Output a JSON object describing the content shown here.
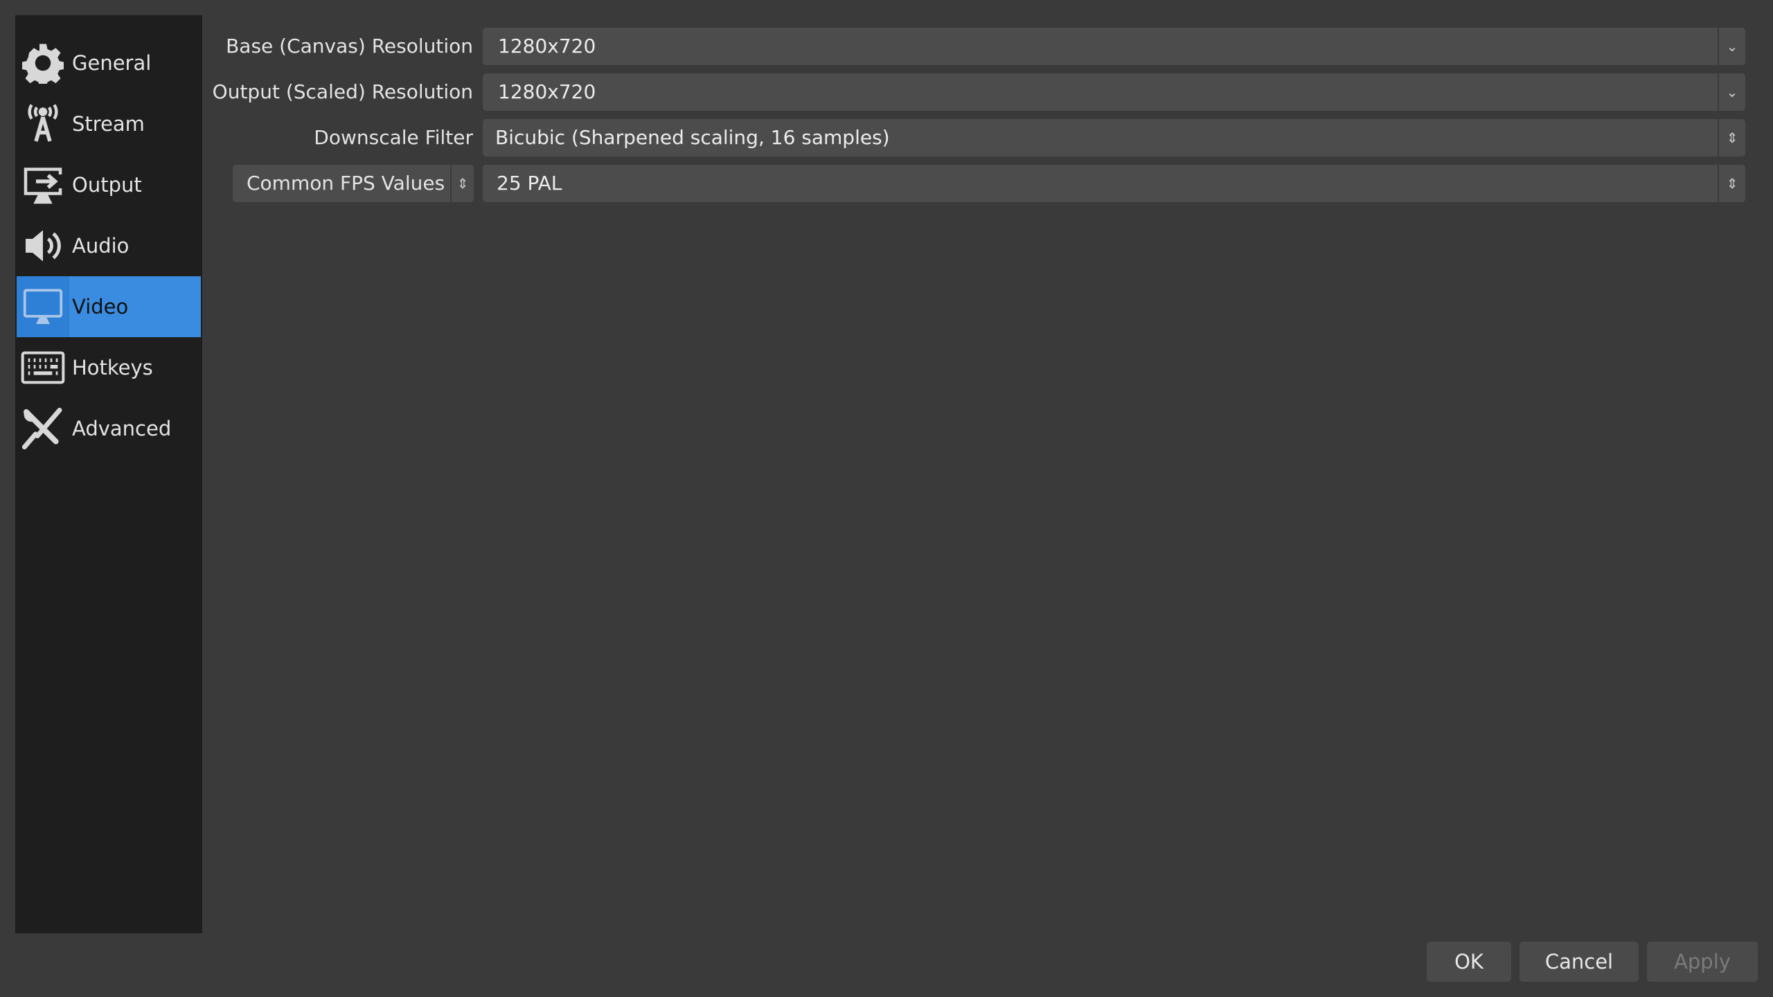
{
  "sidebar": {
    "items": [
      {
        "label": "General",
        "icon": "gear-icon"
      },
      {
        "label": "Stream",
        "icon": "antenna-icon"
      },
      {
        "label": "Output",
        "icon": "monitor-arrow-icon"
      },
      {
        "label": "Audio",
        "icon": "speaker-icon"
      },
      {
        "label": "Video",
        "icon": "monitor-icon",
        "selected": true
      },
      {
        "label": "Hotkeys",
        "icon": "keyboard-icon"
      },
      {
        "label": "Advanced",
        "icon": "tools-icon"
      }
    ]
  },
  "video": {
    "base_label": "Base (Canvas) Resolution",
    "base_value": "1280x720",
    "output_label": "Output (Scaled) Resolution",
    "output_value": "1280x720",
    "filter_label": "Downscale Filter",
    "filter_value": "Bicubic (Sharpened scaling, 16 samples)",
    "fps_type": "Common FPS Values",
    "fps_value": "25 PAL"
  },
  "buttons": {
    "ok": "OK",
    "cancel": "Cancel",
    "apply": "Apply"
  },
  "colors": {
    "accent": "#3a8ce0",
    "background": "#3a3a3a",
    "sidebar": "#1e1e1e"
  }
}
